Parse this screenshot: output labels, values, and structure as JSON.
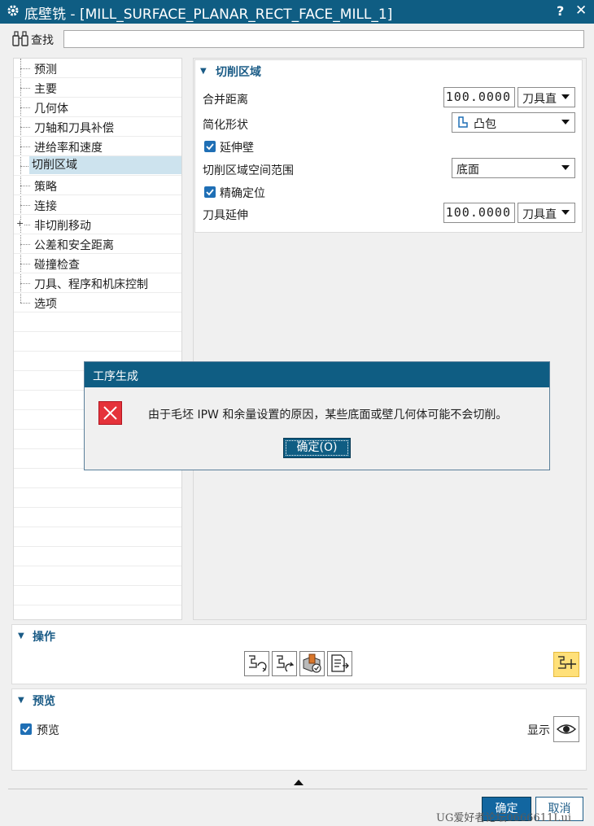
{
  "window": {
    "title": "底壁铣 - [MILL_SURFACE_PLANAR_RECT_FACE_MILL_1]",
    "help": "?",
    "close": "✕"
  },
  "search": {
    "label": "查找",
    "value": ""
  },
  "tree": {
    "items": [
      {
        "label": "预测"
      },
      {
        "label": "主要"
      },
      {
        "label": "几何体"
      },
      {
        "label": "刀轴和刀具补偿"
      },
      {
        "label": "进给率和速度"
      },
      {
        "label": "切削区域",
        "selected": true
      },
      {
        "label": "策略"
      },
      {
        "label": "连接"
      },
      {
        "label": "非切削移动",
        "expandable": true
      },
      {
        "label": "公差和安全距离"
      },
      {
        "label": "碰撞检查"
      },
      {
        "label": "刀具、程序和机床控制"
      },
      {
        "label": "选项"
      }
    ]
  },
  "cut_region": {
    "title": "切削区域",
    "merge_distance": {
      "label": "合并距离",
      "value": "100.0000",
      "unit": "刀具直"
    },
    "simplify_shape": {
      "label": "简化形状",
      "value": "凸包"
    },
    "extend_wall": {
      "label": "延伸壁",
      "checked": true
    },
    "space_range": {
      "label": "切削区域空间范围",
      "value": "底面"
    },
    "precise_locate": {
      "label": "精确定位",
      "checked": true
    },
    "tool_extension": {
      "label": "刀具延伸",
      "value": "100.0000",
      "unit": "刀具直"
    }
  },
  "dialog": {
    "title": "工序生成",
    "message": "由于毛坯 IPW 和余量设置的原因，某些底面或壁几何体可能不会切削。",
    "ok_label": "确定(O)"
  },
  "operations": {
    "title": "操作"
  },
  "preview": {
    "title": "预览",
    "checkbox_label": "预览",
    "checked": true,
    "show_label": "显示"
  },
  "footer": {
    "ok_label": "确定",
    "cancel_label": "取消",
    "watermark": "UG爱好者论坛0666611I.ui"
  },
  "colors": {
    "title_bar": "#0f5d83",
    "accent": "#1a5b86",
    "error": "#e5323a",
    "highlight": "#ffe079"
  }
}
